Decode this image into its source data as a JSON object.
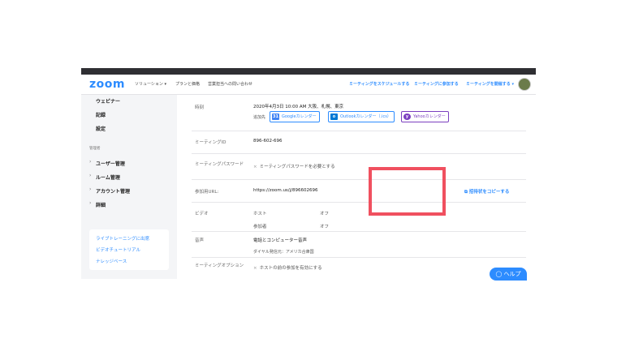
{
  "nav": {
    "logo": "zoom",
    "links": [
      "ソリューション ▾",
      "プランと価格",
      "営業担当への問い合わせ"
    ],
    "right_links": [
      "ミーティングをスケジュールする",
      "ミーティングに参加する",
      "ミーティングを開催する ▾"
    ]
  },
  "sidebar": {
    "items": [
      "ウェビナー",
      "記録",
      "設定"
    ],
    "admin_heading": "管理者",
    "admin_items": [
      "ユーザー管理",
      "ルーム管理",
      "アカウント管理",
      "詳細"
    ],
    "help_links": [
      "ライブトレーニングに出席",
      "ビデオチュートリアル",
      "ナレッジベース"
    ]
  },
  "main": {
    "time_label": "時刻",
    "time_value": "2020年4月3日 10:00 AM 大阪、札幌、東京",
    "add_to_label": "追加先",
    "calendars": [
      "Googleカレンダー",
      "Outlookカレンダー（.ics）",
      "Yahooカレンダー"
    ],
    "meeting_id_label": "ミーティングID",
    "meeting_id_value": "896-602-696",
    "password_label": "ミーティングパスワード",
    "password_value": "ミーティングパスワードを必要とする",
    "join_url_label": "参加用URL:",
    "join_url_value": "https://zoom.us/j/896602696",
    "copy_invite": "招待状をコピーする",
    "video_label": "ビデオ",
    "video_host": "ホスト",
    "video_host_value": "オフ",
    "video_participant": "参加者",
    "video_participant_value": "オフ",
    "audio_label": "音声",
    "audio_value": "電話とコンピューター音声",
    "dialin_value": "ダイヤル発信元：アメリカ合衆国",
    "options_label": "ミーティングオプション",
    "options_value": "ホストの前の参加を有効にする"
  },
  "help_button": "ヘルプ",
  "colors": {
    "brand": "#2d8cff",
    "highlight": "#f0505f"
  }
}
